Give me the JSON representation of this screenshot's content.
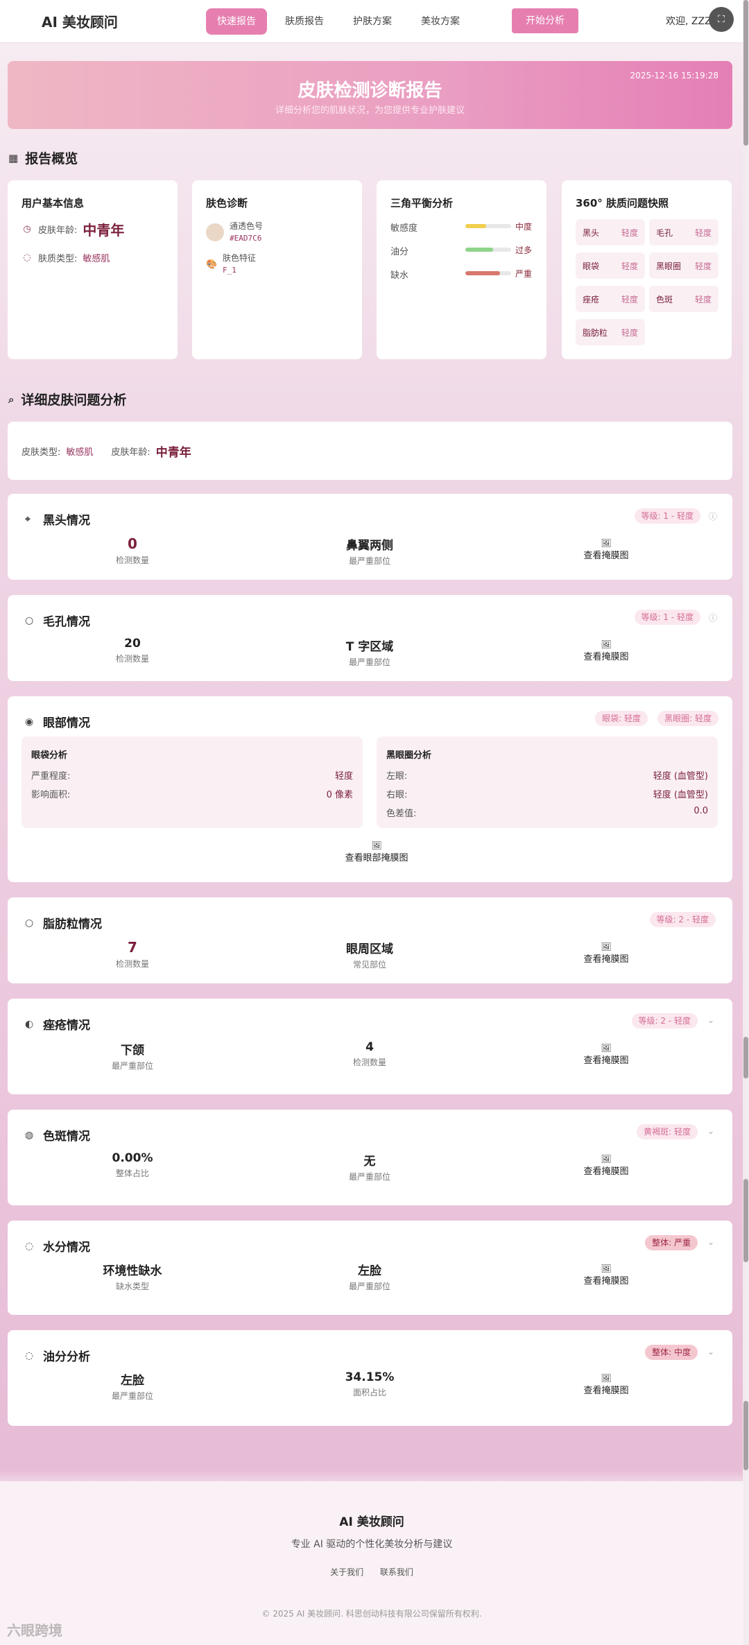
{
  "nav": {
    "brand": "AI 美妆顾问",
    "links": [
      "快速报告",
      "肤质报告",
      "护肤方案",
      "美妆方案"
    ],
    "start": "开始分析",
    "welcome": "欢迎, ZZZ"
  },
  "hero": {
    "title": "皮肤检测诊断报告",
    "subtitle": "详细分析您的肌肤状况，为您提供专业护肤建议",
    "date": "2025-12-16 15:19:28"
  },
  "overview": {
    "title": "报告概览",
    "user": {
      "title": "用户基本信息",
      "age_label": "皮肤年龄:",
      "age": "中青年",
      "type_label": "肤质类型:",
      "type": "敏感肌"
    },
    "color": {
      "title": "肤色诊断",
      "swatch": "#EAD7C6",
      "tone_label": "通透色号",
      "tone_value": "#EAD7C6",
      "feat_label": "肤色特征",
      "feat_value": "F_1"
    },
    "balance": {
      "title": "三角平衡分析",
      "items": [
        {
          "label": "敏感度",
          "level": "中度",
          "pct": 0.45,
          "color": "#f2cf4e"
        },
        {
          "label": "油分",
          "level": "过多",
          "pct": 0.6,
          "color": "#8fd48a"
        },
        {
          "label": "缺水",
          "level": "严重",
          "pct": 0.75,
          "color": "#d9786e"
        }
      ]
    },
    "snap": {
      "title": "360° 肤质问题快照",
      "items": [
        {
          "n": "黑头",
          "s": "轻度"
        },
        {
          "n": "毛孔",
          "s": "轻度"
        },
        {
          "n": "眼袋",
          "s": "轻度"
        },
        {
          "n": "黑眼圈",
          "s": "轻度"
        },
        {
          "n": "痤疮",
          "s": "轻度"
        },
        {
          "n": "色斑",
          "s": "轻度"
        },
        {
          "n": "脂肪粒",
          "s": "轻度"
        }
      ]
    }
  },
  "detail": {
    "title": "详细皮肤问题分析",
    "summary": {
      "type_label": "皮肤类型:",
      "type": "敏感肌",
      "age_label": "皮肤年龄:",
      "age": "中青年"
    },
    "mask_label": "查看掩膜图",
    "blackhead": {
      "title": "黑头情况",
      "badge": "等级: 1 - 轻度",
      "count": "0",
      "count_label": "检测数量",
      "area": "鼻翼两侧",
      "area_label": "最严重部位"
    },
    "pore": {
      "title": "毛孔情况",
      "badge": "等级: 1 - 轻度",
      "count": "20",
      "count_label": "检测数量",
      "area": "T 字区域",
      "area_label": "最严重部位"
    },
    "eye": {
      "title": "眼部情况",
      "badge1": "眼袋: 轻度",
      "badge2": "黑眼圈: 轻度",
      "bag": {
        "title": "眼袋分析",
        "k1": "严重程度:",
        "v1": "轻度",
        "k2": "影响面积:",
        "v2": "0 像素"
      },
      "circle": {
        "title": "黑眼圈分析",
        "k1": "左眼:",
        "v1": "轻度 (血管型)",
        "k2": "右眼:",
        "v2": "轻度 (血管型)",
        "k3": "色差值:",
        "v3": "0.0"
      },
      "mask": "查看眼部掩膜图"
    },
    "milia": {
      "title": "脂肪粒情况",
      "badge": "等级: 2 - 轻度",
      "count": "7",
      "count_label": "检测数量",
      "area": "眼周区域",
      "area_label": "常见部位"
    },
    "acne": {
      "title": "痤疮情况",
      "badge": "等级: 2 - 轻度",
      "area": "下颌",
      "area_label": "最严重部位",
      "count": "4",
      "count_label": "检测数量"
    },
    "spot": {
      "title": "色斑情况",
      "badge": "黄褐斑: 轻度",
      "ratio": "0.00%",
      "ratio_label": "整体占比",
      "area": "无",
      "area_label": "最严重部位"
    },
    "water": {
      "title": "水分情况",
      "badge": "整体: 严重",
      "type": "环境性缺水",
      "type_label": "缺水类型",
      "area": "左脸",
      "area_label": "最严重部位"
    },
    "oil": {
      "title": "油分分析",
      "badge": "整体: 中度",
      "area": "左脸",
      "area_label": "最严重部位",
      "ratio": "34.15%",
      "ratio_label": "面积占比"
    }
  },
  "footer": {
    "brand": "AI 美妆顾问",
    "sub": "专业 AI 驱动的个性化美妆分析与建议",
    "about": "关于我们",
    "contact": "联系我们",
    "copy": "© 2025 AI 美妆顾问. 科思创动科技有限公司保留所有权利."
  },
  "watermark": "六眼跨境"
}
